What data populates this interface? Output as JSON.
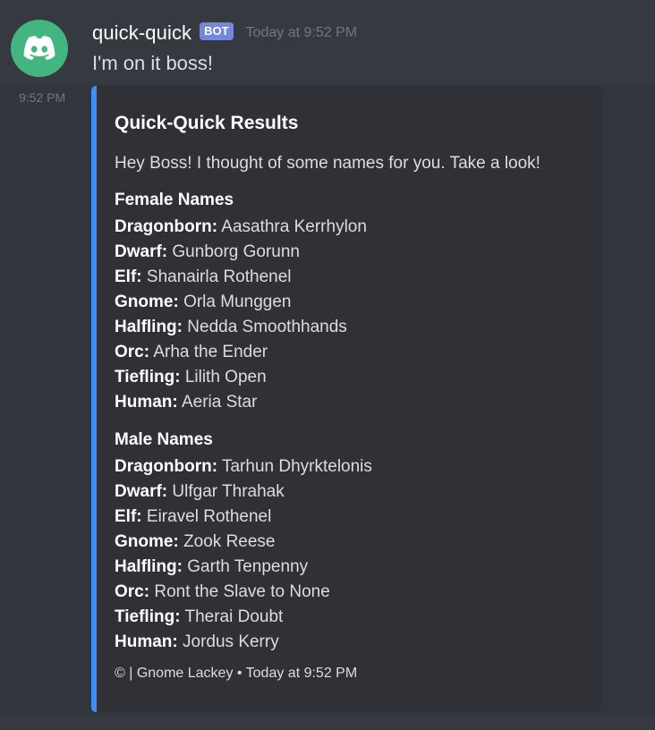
{
  "message": {
    "username": "quick-quick",
    "bot_tag": "BOT",
    "timestamp": "Today at 9:52 PM",
    "text": "I'm on it boss!",
    "side_time": "9:52 PM"
  },
  "embed": {
    "accent_color": "#3e8ef7",
    "title": "Quick-Quick Results",
    "description": "Hey Boss! I thought of some names for you. Take a look!",
    "fields": [
      {
        "name": "Female Names",
        "entries": [
          {
            "race": "Dragonborn:",
            "value": "Aasathra Kerrhylon"
          },
          {
            "race": "Dwarf:",
            "value": "Gunborg Gorunn"
          },
          {
            "race": "Elf:",
            "value": "Shanairla Rothenel"
          },
          {
            "race": "Gnome:",
            "value": "Orla Munggen"
          },
          {
            "race": "Halfling:",
            "value": "Nedda Smoothhands"
          },
          {
            "race": "Orc:",
            "value": "Arha the Ender"
          },
          {
            "race": "Tiefling:",
            "value": "Lilith Open"
          },
          {
            "race": "Human:",
            "value": "Aeria Star"
          }
        ]
      },
      {
        "name": "Male Names",
        "entries": [
          {
            "race": "Dragonborn:",
            "value": "Tarhun Dhyrktelonis"
          },
          {
            "race": "Dwarf:",
            "value": "Ulfgar Thrahak"
          },
          {
            "race": "Elf:",
            "value": "Eiravel Rothenel"
          },
          {
            "race": "Gnome:",
            "value": "Zook Reese"
          },
          {
            "race": "Halfling:",
            "value": "Garth Tenpenny"
          },
          {
            "race": "Orc:",
            "value": "Ront the Slave to None"
          },
          {
            "race": "Tiefling:",
            "value": "Therai Doubt"
          },
          {
            "race": "Human:",
            "value": "Jordus Kerry"
          }
        ]
      }
    ],
    "footer": "© | Gnome Lackey • Today at 9:52 PM"
  },
  "icons": {
    "avatar": "discord-logo-icon"
  },
  "colors": {
    "background": "#36393f",
    "avatar_bg": "#43b581",
    "bot_tag_bg": "#7289da"
  }
}
